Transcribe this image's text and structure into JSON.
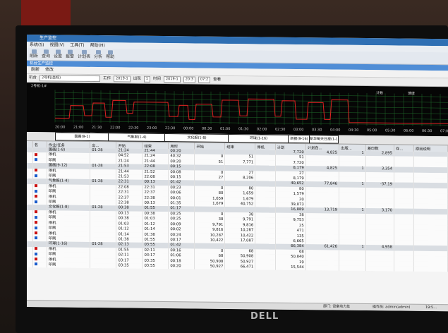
{
  "window": {
    "title": "生产监控"
  },
  "menu": [
    "系统(S)",
    "视图(V)",
    "工具(T)",
    "帮助(H)"
  ],
  "toolbar": [
    "刷新",
    "查询",
    "设置",
    "报警",
    "计划表",
    "分析",
    "帮助"
  ],
  "panel_title": "机台生产监控",
  "subtoolbar": {
    "refresh": "刷新",
    "edit": "修改"
  },
  "filter": {
    "machine_label": "机台",
    "machine_value": "2号机(坐标)",
    "process_label": "工作",
    "process_value": "2019-1",
    "output_label": "出现",
    "output_value": "1",
    "time_label": "时间",
    "time_value": "2019-1",
    "hour_value": "20:3",
    "count_value": "07:2",
    "query": "查看"
  },
  "chart": {
    "title": "2号机-1#",
    "right_labels": [
      "计数",
      "速度"
    ],
    "xticks": [
      "20:00",
      "21:00",
      "21:30",
      "22:00",
      "22:30",
      "23:00",
      "23:30",
      "00:00",
      "00:30",
      "01:00",
      "01:30",
      "02:00",
      "02:30",
      "03:00",
      "03:30",
      "04:00",
      "04:30",
      "05:00",
      "05:30",
      "06:00",
      "06:30",
      "07:00"
    ]
  },
  "timeline": [
    "国画(9-1)",
    "气象报(1-4)",
    "文化报(1-8)",
    "环球(1-16)",
    "新报(9-16)",
    "新华每天日报(1-16)"
  ],
  "table": {
    "headers": [
      "",
      "名",
      "作业/任务",
      "出...",
      "开始",
      "结束",
      "用时",
      "开始",
      "结束",
      "停机",
      "计划",
      "计划白...",
      "出版...",
      "差印数",
      "存...",
      "原因说明"
    ],
    "rows": [
      {
        "type": "group",
        "name": "国画(1-8)",
        "date": "01-28",
        "start": "21:24",
        "end": "21:44",
        "dur": "00:20",
        "a": "",
        "b": "",
        "c": "7,720",
        "d": "4,825",
        "e": "1",
        "f": "2,895"
      },
      {
        "type": "item",
        "mark": "#cc1111",
        "name": "停机",
        "start": "04:52",
        "end": "21:24",
        "dur": "40:32",
        "a": "0",
        "b": "51",
        "c": "51",
        "d": "",
        "e": "",
        "f": ""
      },
      {
        "type": "item",
        "mark": "#1a5ccc",
        "name": "印刷",
        "start": "21:24",
        "end": "21:44",
        "dur": "00:20",
        "a": "51",
        "b": "7,771",
        "c": "7,720",
        "d": "",
        "e": "",
        "f": ""
      },
      {
        "type": "group",
        "name": "国画(9-12)",
        "date": "01-28",
        "start": "21:53",
        "end": "22:08",
        "dur": "00:15",
        "a": "",
        "b": "",
        "c": "8,179",
        "d": "4,825",
        "e": "1",
        "f": "3,354"
      },
      {
        "type": "item",
        "mark": "#cc1111",
        "name": "停机",
        "start": "21:44",
        "end": "21:52",
        "dur": "00:08",
        "a": "0",
        "b": "27",
        "c": "27",
        "d": "",
        "e": "",
        "f": ""
      },
      {
        "type": "item",
        "mark": "#1a5ccc",
        "name": "印刷",
        "start": "21:53",
        "end": "22:08",
        "dur": "00:15",
        "a": "27",
        "b": "8,206",
        "c": "8,179",
        "d": "",
        "e": "",
        "f": ""
      },
      {
        "type": "group",
        "name": "气象报(1-4)",
        "date": "01-28",
        "start": "22:31",
        "end": "00:13",
        "dur": "01:42",
        "a": "",
        "b": "",
        "c": "40,652",
        "d": "77,846",
        "e": "1",
        "f": "-37,19"
      },
      {
        "type": "item",
        "mark": "#cc1111",
        "name": "停机",
        "start": "22:08",
        "end": "22:31",
        "dur": "00:23",
        "a": "0",
        "b": "80",
        "c": "80",
        "d": "",
        "e": "",
        "f": ""
      },
      {
        "type": "item",
        "mark": "#1a5ccc",
        "name": "印刷",
        "start": "22:31",
        "end": "22:37",
        "dur": "00:06",
        "a": "80",
        "b": "1,659",
        "c": "1,579",
        "d": "",
        "e": "",
        "f": ""
      },
      {
        "type": "item",
        "mark": "#cc1111",
        "name": "停机",
        "start": "22:37",
        "end": "22:38",
        "dur": "00:01",
        "a": "1,659",
        "b": "1,679",
        "c": "20",
        "d": "",
        "e": "",
        "f": ""
      },
      {
        "type": "item",
        "mark": "#1a5ccc",
        "name": "印刷",
        "start": "22:38",
        "end": "00:13",
        "dur": "01:35",
        "a": "1,679",
        "b": "40,752",
        "c": "39,073",
        "d": "",
        "e": "",
        "f": ""
      },
      {
        "type": "group",
        "name": "文化报(1-8)",
        "date": "01-28",
        "start": "00:38",
        "end": "01:55",
        "dur": "01:17",
        "a": "",
        "b": "",
        "c": "16,889",
        "d": "13,719",
        "e": "1",
        "f": "3,170"
      },
      {
        "type": "item",
        "mark": "#cc1111",
        "name": "停机",
        "start": "00:13",
        "end": "00:38",
        "dur": "00:25",
        "a": "0",
        "b": "38",
        "c": "38",
        "d": "",
        "e": "",
        "f": ""
      },
      {
        "type": "item",
        "mark": "#1a5ccc",
        "name": "印刷",
        "start": "00:38",
        "end": "01:03",
        "dur": "00:25",
        "a": "38",
        "b": "9,791",
        "c": "9,753",
        "d": "",
        "e": "",
        "f": ""
      },
      {
        "type": "item",
        "mark": "#cc1111",
        "name": "停机",
        "start": "01:03",
        "end": "01:12",
        "dur": "00:09",
        "a": "9,791",
        "b": "9,816",
        "c": "25",
        "d": "",
        "e": "",
        "f": ""
      },
      {
        "type": "item",
        "mark": "#1a5ccc",
        "name": "印刷",
        "start": "01:12",
        "end": "01:14",
        "dur": "00:02",
        "a": "9,816",
        "b": "10,287",
        "c": "471",
        "d": "",
        "e": "",
        "f": ""
      },
      {
        "type": "item",
        "mark": "#cc1111",
        "name": "停机",
        "start": "01:14",
        "end": "01:38",
        "dur": "00:24",
        "a": "10,287",
        "b": "10,422",
        "c": "135",
        "d": "",
        "e": "",
        "f": ""
      },
      {
        "type": "item",
        "mark": "#1a5ccc",
        "name": "印刷",
        "start": "01:38",
        "end": "01:55",
        "dur": "00:17",
        "a": "10,422",
        "b": "17,087",
        "c": "6,665",
        "d": "",
        "e": "",
        "f": ""
      },
      {
        "type": "group",
        "name": "环球(1-16)",
        "date": "01-28",
        "start": "02:13",
        "end": "03:55",
        "dur": "01:42",
        "a": "",
        "b": "",
        "c": "66,384",
        "d": "61,426",
        "e": "1",
        "f": "4,958"
      },
      {
        "type": "item",
        "mark": "#cc1111",
        "name": "停机",
        "start": "01:55",
        "end": "02:11",
        "dur": "00:16",
        "a": "0",
        "b": "68",
        "c": "68",
        "d": "",
        "e": "",
        "f": ""
      },
      {
        "type": "item",
        "mark": "#1a5ccc",
        "name": "印刷",
        "start": "02:11",
        "end": "03:17",
        "dur": "01:06",
        "a": "68",
        "b": "50,908",
        "c": "50,840",
        "d": "",
        "e": "",
        "f": ""
      },
      {
        "type": "item",
        "mark": "#cc1111",
        "name": "停机",
        "start": "03:17",
        "end": "03:35",
        "dur": "00:18",
        "a": "50,908",
        "b": "50,927",
        "c": "19",
        "d": "",
        "e": "",
        "f": ""
      },
      {
        "type": "item",
        "mark": "#1a5ccc",
        "name": "印刷",
        "start": "03:35",
        "end": "03:55",
        "dur": "00:20",
        "a": "50,927",
        "b": "66,471",
        "c": "15,544",
        "d": "",
        "e": "",
        "f": ""
      }
    ]
  },
  "status": {
    "dept": "部门: 设备动力处",
    "operator": "操作员: admin(admin)",
    "time": "19:5..."
  },
  "brand": "DELL"
}
